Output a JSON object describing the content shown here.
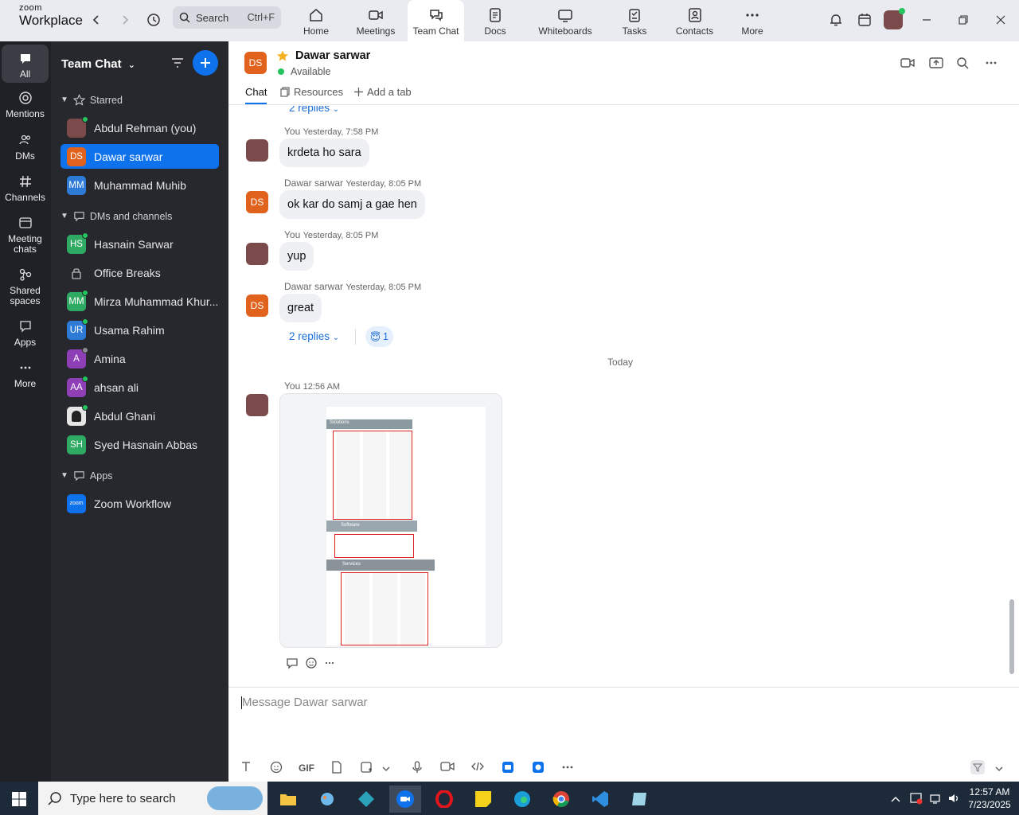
{
  "app": {
    "brand_top": "zoom",
    "brand_bottom": "Workplace"
  },
  "search": {
    "label": "Search",
    "shortcut": "Ctrl+F"
  },
  "tabs": [
    {
      "label": "Home"
    },
    {
      "label": "Meetings"
    },
    {
      "label": "Team Chat"
    },
    {
      "label": "Docs"
    },
    {
      "label": "Whiteboards"
    },
    {
      "label": "Tasks"
    },
    {
      "label": "Contacts"
    },
    {
      "label": "More"
    }
  ],
  "rail": [
    {
      "label": "All"
    },
    {
      "label": "Mentions"
    },
    {
      "label": "DMs"
    },
    {
      "label": "Channels"
    },
    {
      "label": "Meeting chats"
    },
    {
      "label": "Shared spaces"
    },
    {
      "label": "Apps"
    },
    {
      "label": "More"
    }
  ],
  "sidebar": {
    "title": "Team Chat",
    "starred_header": "Starred",
    "starred": [
      {
        "name": "Abdul Rehman (you)",
        "initials": "",
        "color": "#7b4a4a",
        "status": "online"
      },
      {
        "name": "Dawar sarwar",
        "initials": "DS",
        "color": "#e0621c",
        "status": ""
      },
      {
        "name": "Muhammad Muhib",
        "initials": "MM",
        "color": "#2d7bd6",
        "status": ""
      }
    ],
    "dms_header": "DMs and channels",
    "dms": [
      {
        "name": "Hasnain Sarwar",
        "initials": "HS",
        "color": "#2faa63",
        "status": "online"
      },
      {
        "name": "Office Breaks",
        "initials": "",
        "color": "",
        "status": ""
      },
      {
        "name": "Mirza Muhammad Khur...",
        "initials": "MM",
        "color": "#2faa63",
        "status": "online"
      },
      {
        "name": "Usama Rahim",
        "initials": "UR",
        "color": "#2d7bd6",
        "status": "online"
      },
      {
        "name": "Amina",
        "initials": "A",
        "color": "#8e3fb5",
        "status": "grey"
      },
      {
        "name": "ahsan ali",
        "initials": "AA",
        "color": "#8e3fb5",
        "status": "online"
      },
      {
        "name": "Abdul Ghani",
        "initials": "",
        "color": "#ddd",
        "status": "online"
      },
      {
        "name": "Syed Hasnain Abbas",
        "initials": "SH",
        "color": "#2faa63",
        "status": ""
      }
    ],
    "apps_header": "Apps",
    "apps": [
      {
        "name": "Zoom Workflow",
        "initials": "zoom",
        "color": "#0e72ed"
      }
    ]
  },
  "chat": {
    "contact_initials": "DS",
    "contact_name": "Dawar sarwar",
    "contact_status": "Available",
    "tab_chat": "Chat",
    "tab_resources": "Resources",
    "tab_add": "Add a tab",
    "top_replies": "2 replies",
    "messages": [
      {
        "author": "You",
        "time": "Yesterday, 7:58 PM",
        "text": "krdeta ho sara"
      },
      {
        "author": "Dawar sarwar",
        "time": "Yesterday, 8:05 PM",
        "text": "ok kar do samj a gae hen"
      },
      {
        "author": "You",
        "time": "Yesterday, 8:05 PM",
        "text": "yup"
      },
      {
        "author": "Dawar sarwar",
        "time": "Yesterday, 8:05 PM",
        "text": "great"
      }
    ],
    "replies_label": "2 replies",
    "reaction_emoji": "😇",
    "reaction_count": "1",
    "day_divider": "Today",
    "last_author": "You",
    "last_time": "12:56 AM",
    "image_labels": [
      "Solutions",
      "Software",
      "Services"
    ],
    "composer_placeholder": "Message Dawar sarwar",
    "gif_label": "GIF"
  },
  "taskbar": {
    "search_placeholder": "Type here to search",
    "time": "12:57 AM",
    "date": "7/23/2025"
  }
}
